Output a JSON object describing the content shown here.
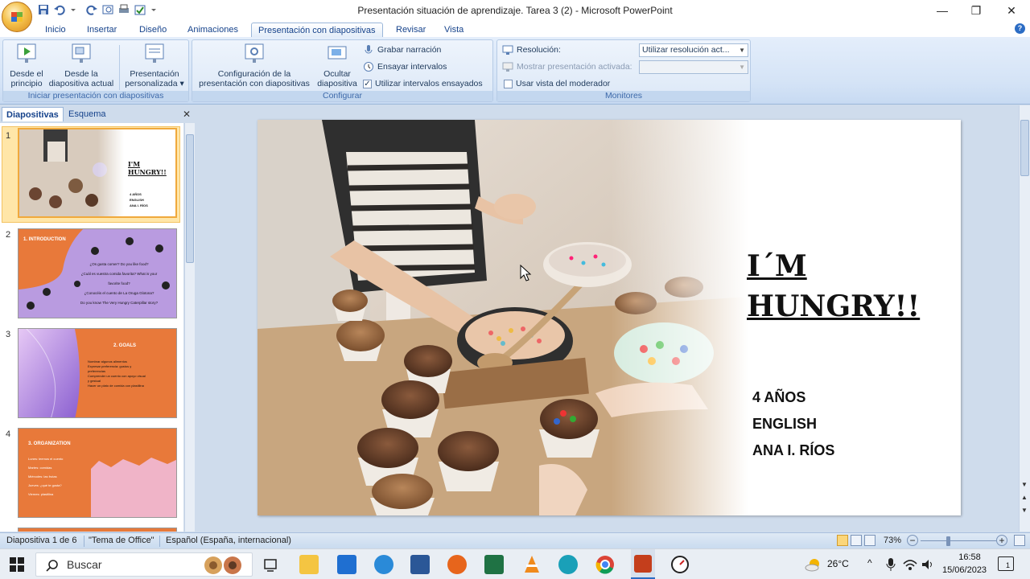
{
  "window": {
    "title": "Presentación situación de aprendizaje. Tarea 3 (2) - Microsoft PowerPoint",
    "controls": [
      "—",
      "❐",
      "✕"
    ]
  },
  "ribbon_tabs": [
    "Inicio",
    "Insertar",
    "Diseño",
    "Animaciones",
    "Presentación con diapositivas",
    "Revisar",
    "Vista"
  ],
  "active_tab": "Presentación con diapositivas",
  "ribbon": {
    "start_group": {
      "label": "Iniciar presentación con diapositivas",
      "from_start": "Desde el\nprincipio",
      "from_current": "Desde la\ndiapositiva actual",
      "custom": "Presentación\npersonalizada ▾"
    },
    "config_group": {
      "label": "Configurar",
      "setup": "Configuración de la\npresentación con diapositivas",
      "hide": "Ocultar\ndiapositiva",
      "record": "Grabar narración",
      "rehearse": "Ensayar intervalos",
      "use_timings": "Utilizar intervalos ensayados",
      "use_timings_checked": true
    },
    "monitors_group": {
      "label": "Monitores",
      "resolution_label": "Resolución:",
      "resolution_value": "Utilizar resolución act...",
      "show_on_label": "Mostrar presentación activada:",
      "presenter_view": "Usar vista del moderador",
      "presenter_view_checked": false
    }
  },
  "left_pane": {
    "tabs": [
      "Diapositivas",
      "Esquema"
    ],
    "close": "✕",
    "thumbs": [
      {
        "num": "1",
        "title": "I'M\nHUNGRY!!",
        "lines": [
          "4 AÑOS",
          "ENGLISH",
          "ANA I. RÍOS"
        ]
      },
      {
        "num": "2",
        "title": "1. INTRODUCTION",
        "lines": [
          "¿Os gusta comer? Do you like food?",
          "¿Cuál es vuestra comida favorita? What is your",
          "favorite food?",
          "¿Conocéis el cuento de La Oruga Glotona?",
          "Do you know The Very Hungry Caterpillar story?"
        ]
      },
      {
        "num": "3",
        "title": "2. GOALS",
        "lines": [
          "Nombrar algunos alimentos",
          "Expresar preferencia: gustos y",
          "preferencias",
          "Comprender un cuento con apoyo visual",
          "y gestual",
          "Hacer un plato de comida con plastilina"
        ]
      },
      {
        "num": "4",
        "title": "3. ORGANIZATION",
        "lines": [
          "Lunes: leemos el cuento",
          "Martes: comidas",
          "Miércoles: las frutas",
          "Jueves: ¿qué te gusta?",
          "Viernes: plastilina"
        ]
      }
    ]
  },
  "slide": {
    "title": "I´M\nHUNGRY!!",
    "sub1": "4 AÑOS",
    "sub2": "ENGLISH",
    "sub3": "ANA I. RÍOS"
  },
  "status": {
    "slide_count": "Diapositiva 1 de 6",
    "theme": "\"Tema de Office\"",
    "language": "Español (España, internacional)",
    "zoom": "73%",
    "zoom_level": 0.73
  },
  "taskbar": {
    "search_placeholder": "Buscar",
    "weather": "26°C",
    "time": "16:58",
    "date": "15/06/2023",
    "notifications": "1"
  },
  "colors": {
    "accent": "#15428b",
    "ribbon": "#dce8f7",
    "slide2_orange": "#e8793a",
    "slide2_purple": "#b99be0",
    "selected_thumb": "#f0a93c"
  }
}
